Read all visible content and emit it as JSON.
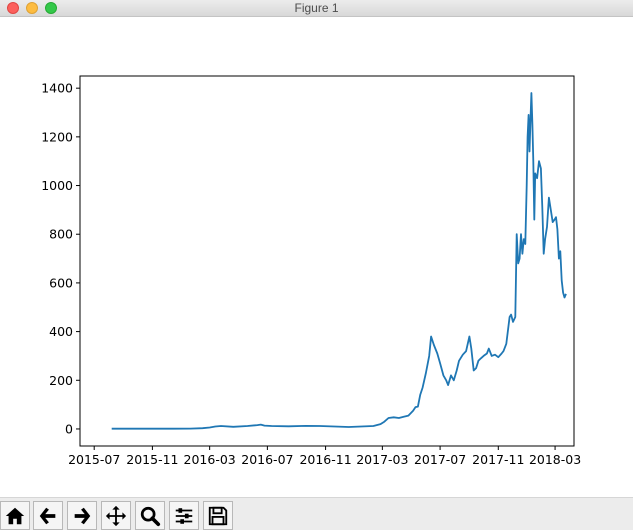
{
  "window": {
    "title": "Figure 1"
  },
  "toolbar": {
    "buttons": [
      {
        "name": "home-icon",
        "tooltip": "Home"
      },
      {
        "name": "back-arrow-icon",
        "tooltip": "Back"
      },
      {
        "name": "forward-arrow-icon",
        "tooltip": "Forward"
      },
      {
        "name": "pan-move-icon",
        "tooltip": "Pan"
      },
      {
        "name": "zoom-magnifier-icon",
        "tooltip": "Zoom"
      },
      {
        "name": "sliders-icon",
        "tooltip": "Configure subplots"
      },
      {
        "name": "save-floppy-icon",
        "tooltip": "Save"
      }
    ]
  },
  "chart_data": {
    "type": "line",
    "title": "",
    "xlabel": "",
    "ylabel": "",
    "color": "#1f77b4",
    "grid": false,
    "legend": "none",
    "xlim": [
      "2015-06-01",
      "2018-04-10"
    ],
    "ylim": [
      -70,
      1450
    ],
    "x_ticks": [
      "2015-07",
      "2015-11",
      "2016-03",
      "2016-07",
      "2016-11",
      "2017-03",
      "2017-07",
      "2017-11",
      "2018-03"
    ],
    "y_ticks": [
      0,
      200,
      400,
      600,
      800,
      1000,
      1200,
      1400
    ],
    "series": [
      {
        "x": [
          "2015-08-07",
          "2015-09-15",
          "2015-11-01",
          "2015-12-15",
          "2016-01-20",
          "2016-02-15",
          "2016-03-01",
          "2016-03-13",
          "2016-03-25",
          "2016-04-20",
          "2016-05-20",
          "2016-06-10",
          "2016-06-17",
          "2016-06-25",
          "2016-07-10",
          "2016-08-15",
          "2016-09-20",
          "2016-10-20",
          "2016-11-20",
          "2016-12-20",
          "2017-01-15",
          "2017-02-10",
          "2017-02-25",
          "2017-03-05",
          "2017-03-14",
          "2017-03-25",
          "2017-04-05",
          "2017-04-15",
          "2017-04-25",
          "2017-05-05",
          "2017-05-10",
          "2017-05-15",
          "2017-05-20",
          "2017-05-25",
          "2017-06-01",
          "2017-06-08",
          "2017-06-12",
          "2017-06-18",
          "2017-06-25",
          "2017-07-01",
          "2017-07-08",
          "2017-07-14",
          "2017-07-18",
          "2017-07-24",
          "2017-07-30",
          "2017-08-05",
          "2017-08-10",
          "2017-08-18",
          "2017-08-25",
          "2017-09-01",
          "2017-09-05",
          "2017-09-10",
          "2017-09-15",
          "2017-09-20",
          "2017-09-25",
          "2017-10-01",
          "2017-10-08",
          "2017-10-12",
          "2017-10-18",
          "2017-10-25",
          "2017-11-01",
          "2017-11-08",
          "2017-11-12",
          "2017-11-18",
          "2017-11-25",
          "2017-11-28",
          "2017-12-02",
          "2017-12-07",
          "2017-12-10",
          "2017-12-13",
          "2017-12-16",
          "2017-12-19",
          "2017-12-22",
          "2017-12-25",
          "2017-12-28",
          "2017-12-31",
          "2018-01-02",
          "2018-01-04",
          "2018-01-06",
          "2018-01-08",
          "2018-01-10",
          "2018-01-12",
          "2018-01-14",
          "2018-01-16",
          "2018-01-18",
          "2018-01-22",
          "2018-01-26",
          "2018-01-30",
          "2018-02-02",
          "2018-02-05",
          "2018-02-08",
          "2018-02-12",
          "2018-02-16",
          "2018-02-20",
          "2018-02-24",
          "2018-02-28",
          "2018-03-03",
          "2018-03-06",
          "2018-03-09",
          "2018-03-12",
          "2018-03-15",
          "2018-03-18",
          "2018-03-21",
          "2018-03-24"
        ],
        "values": [
          1.2,
          1.0,
          1.0,
          0.9,
          1.5,
          3.0,
          6.0,
          10.0,
          12.0,
          9.0,
          12.0,
          16.0,
          18.0,
          14.0,
          12.0,
          11.0,
          12.5,
          12.0,
          10.0,
          8.0,
          10.0,
          12.0,
          20.0,
          30.0,
          45.0,
          48.0,
          45.0,
          50.0,
          55.0,
          75.0,
          90.0,
          92.0,
          140.0,
          170.0,
          230.0,
          300.0,
          380.0,
          345.0,
          310.0,
          270.0,
          220.0,
          200.0,
          180.0,
          220.0,
          200.0,
          240.0,
          280.0,
          305.0,
          320.0,
          380.0,
          330.0,
          240.0,
          250.0,
          280.0,
          290.0,
          300.0,
          310.0,
          330.0,
          300.0,
          305.0,
          295.0,
          310.0,
          320.0,
          350.0,
          460.0,
          470.0,
          440.0,
          460.0,
          800.0,
          680.0,
          700.0,
          800.0,
          720.0,
          780.0,
          760.0,
          1000.0,
          1200.0,
          1290.0,
          1140.0,
          1270.0,
          1380.0,
          1250.0,
          1100.0,
          860.0,
          1050.0,
          1030.0,
          1100.0,
          1070.0,
          910.0,
          720.0,
          780.0,
          830.0,
          950.0,
          900.0,
          850.0,
          860.0,
          870.0,
          820.0,
          700.0,
          730.0,
          610.0,
          560.0,
          540.0,
          555.0
        ]
      }
    ]
  }
}
